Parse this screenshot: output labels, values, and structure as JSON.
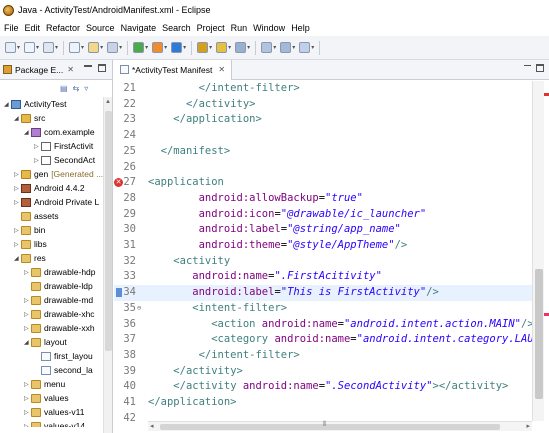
{
  "window": {
    "title": "Java - ActivityTest/AndroidManifest.xml - Eclipse"
  },
  "menu": [
    "File",
    "Edit",
    "Refactor",
    "Source",
    "Navigate",
    "Search",
    "Project",
    "Run",
    "Window",
    "Help"
  ],
  "package_explorer": {
    "tab_label": "Package E...",
    "tree": [
      {
        "label": "ActivityTest",
        "icon": "project-icon",
        "twisty": "◢",
        "indent": 0
      },
      {
        "label": "src",
        "icon": "source-folder-icon",
        "twisty": "◢",
        "indent": 1
      },
      {
        "label": "com.example",
        "icon": "package-icon",
        "twisty": "◢",
        "indent": 2
      },
      {
        "label": "FirstActivit",
        "icon": "java-file-icon",
        "twisty": "▷",
        "indent": 3
      },
      {
        "label": "SecondAct",
        "icon": "java-file-icon",
        "twisty": "▷",
        "indent": 3
      },
      {
        "label": "gen",
        "label2": "[Generated ...",
        "icon": "source-folder-icon",
        "twisty": "▷",
        "indent": 1
      },
      {
        "label": "Android 4.4.2",
        "icon": "library-icon",
        "twisty": "▷",
        "indent": 1
      },
      {
        "label": "Android Private L",
        "icon": "library-icon",
        "twisty": "▷",
        "indent": 1
      },
      {
        "label": "assets",
        "icon": "folder-icon",
        "twisty": "",
        "indent": 1
      },
      {
        "label": "bin",
        "icon": "folder-icon",
        "twisty": "▷",
        "indent": 1
      },
      {
        "label": "libs",
        "icon": "folder-icon",
        "twisty": "▷",
        "indent": 1
      },
      {
        "label": "res",
        "icon": "folder-icon",
        "twisty": "◢",
        "indent": 1
      },
      {
        "label": "drawable-hdp",
        "icon": "folder-icon",
        "twisty": "▷",
        "indent": 2
      },
      {
        "label": "drawable-ldp",
        "icon": "folder-icon",
        "twisty": "",
        "indent": 2
      },
      {
        "label": "drawable-md",
        "icon": "folder-icon",
        "twisty": "▷",
        "indent": 2
      },
      {
        "label": "drawable-xhc",
        "icon": "folder-icon",
        "twisty": "▷",
        "indent": 2
      },
      {
        "label": "drawable-xxh",
        "icon": "folder-icon",
        "twisty": "▷",
        "indent": 2
      },
      {
        "label": "layout",
        "icon": "folder-icon",
        "twisty": "◢",
        "indent": 2
      },
      {
        "label": "first_layou",
        "icon": "xml-file-icon",
        "twisty": "",
        "indent": 3
      },
      {
        "label": "second_la",
        "icon": "xml-file-icon",
        "twisty": "",
        "indent": 3
      },
      {
        "label": "menu",
        "icon": "folder-icon",
        "twisty": "▷",
        "indent": 2
      },
      {
        "label": "values",
        "icon": "folder-icon",
        "twisty": "▷",
        "indent": 2
      },
      {
        "label": "values-v11",
        "icon": "folder-icon",
        "twisty": "▷",
        "indent": 2
      },
      {
        "label": "values-v14",
        "icon": "folder-icon",
        "twisty": "▷",
        "indent": 2
      }
    ]
  },
  "editor": {
    "tab_label": "*ActivityTest Manifest",
    "lines": [
      {
        "no": "21",
        "indent": "        ",
        "parts": [
          [
            "tag",
            "</intent-filter>"
          ]
        ]
      },
      {
        "no": "22",
        "indent": "      ",
        "parts": [
          [
            "tag",
            "</activity>"
          ]
        ]
      },
      {
        "no": "23",
        "indent": "    ",
        "parts": [
          [
            "tag",
            "</application>"
          ]
        ]
      },
      {
        "no": "24",
        "indent": "",
        "parts": []
      },
      {
        "no": "25",
        "indent": "  ",
        "parts": [
          [
            "tag",
            "</manifest>"
          ]
        ]
      },
      {
        "no": "26",
        "indent": "",
        "parts": []
      },
      {
        "no": "27",
        "indent": "",
        "marker": "error",
        "parts": [
          [
            "tag",
            "<application"
          ]
        ]
      },
      {
        "no": "28",
        "indent": "        ",
        "parts": [
          [
            "attr",
            "android:allowBackup"
          ],
          [
            "txt",
            "="
          ],
          [
            "val",
            "\"true\""
          ]
        ]
      },
      {
        "no": "29",
        "indent": "        ",
        "parts": [
          [
            "attr",
            "android:icon"
          ],
          [
            "txt",
            "="
          ],
          [
            "val",
            "\"@drawable/ic_launcher\""
          ]
        ]
      },
      {
        "no": "30",
        "indent": "        ",
        "parts": [
          [
            "attr",
            "android:label"
          ],
          [
            "txt",
            "="
          ],
          [
            "val",
            "\"@string/app_name\""
          ]
        ]
      },
      {
        "no": "31",
        "indent": "        ",
        "parts": [
          [
            "attr",
            "android:theme"
          ],
          [
            "txt",
            "="
          ],
          [
            "val",
            "\"@style/AppTheme\""
          ],
          [
            "tag",
            "/>"
          ]
        ]
      },
      {
        "no": "32",
        "indent": "    ",
        "parts": [
          [
            "tag",
            "<activity"
          ]
        ]
      },
      {
        "no": "33",
        "indent": "       ",
        "parts": [
          [
            "attr",
            "android:name"
          ],
          [
            "txt",
            "="
          ],
          [
            "val",
            "\".FirstAcitivity\""
          ]
        ]
      },
      {
        "no": "34",
        "indent": "       ",
        "marker": "bookmark",
        "current": true,
        "parts": [
          [
            "attr",
            "android:label"
          ],
          [
            "txt",
            "="
          ],
          [
            "val",
            "\"This is FirstActivity\""
          ],
          [
            "tag",
            "/>"
          ]
        ]
      },
      {
        "no": "35",
        "indent": "       ",
        "marker": "fold",
        "parts": [
          [
            "tag",
            "<intent-filter>"
          ]
        ]
      },
      {
        "no": "36",
        "indent": "          ",
        "parts": [
          [
            "tag",
            "<action "
          ],
          [
            "attr",
            "android:name"
          ],
          [
            "txt",
            "="
          ],
          [
            "val",
            "\"android.intent.action.MAIN\""
          ],
          [
            "tag",
            "/>"
          ]
        ]
      },
      {
        "no": "37",
        "indent": "          ",
        "parts": [
          [
            "tag",
            "<category "
          ],
          [
            "attr",
            "android:name"
          ],
          [
            "txt",
            "="
          ],
          [
            "val",
            "\"android.intent.category.LAUNCH"
          ]
        ]
      },
      {
        "no": "38",
        "indent": "        ",
        "parts": [
          [
            "tag",
            "</intent-filter>"
          ]
        ]
      },
      {
        "no": "39",
        "indent": "    ",
        "parts": [
          [
            "tag",
            "</activity>"
          ]
        ]
      },
      {
        "no": "40",
        "indent": "    ",
        "parts": [
          [
            "tag",
            "</activity "
          ],
          [
            "attr",
            "android:name"
          ],
          [
            "txt",
            "="
          ],
          [
            "val",
            "\".SecondActivity\""
          ],
          [
            "tag",
            "></activity>"
          ]
        ]
      },
      {
        "no": "41",
        "indent": "",
        "parts": [
          [
            "tag",
            "</application>"
          ]
        ]
      },
      {
        "no": "42",
        "indent": "",
        "parts": []
      }
    ]
  },
  "colors": {
    "tag": "#3f7f7f",
    "attr": "#7f007f",
    "value": "#2a00ff",
    "error": "#dd3333"
  }
}
